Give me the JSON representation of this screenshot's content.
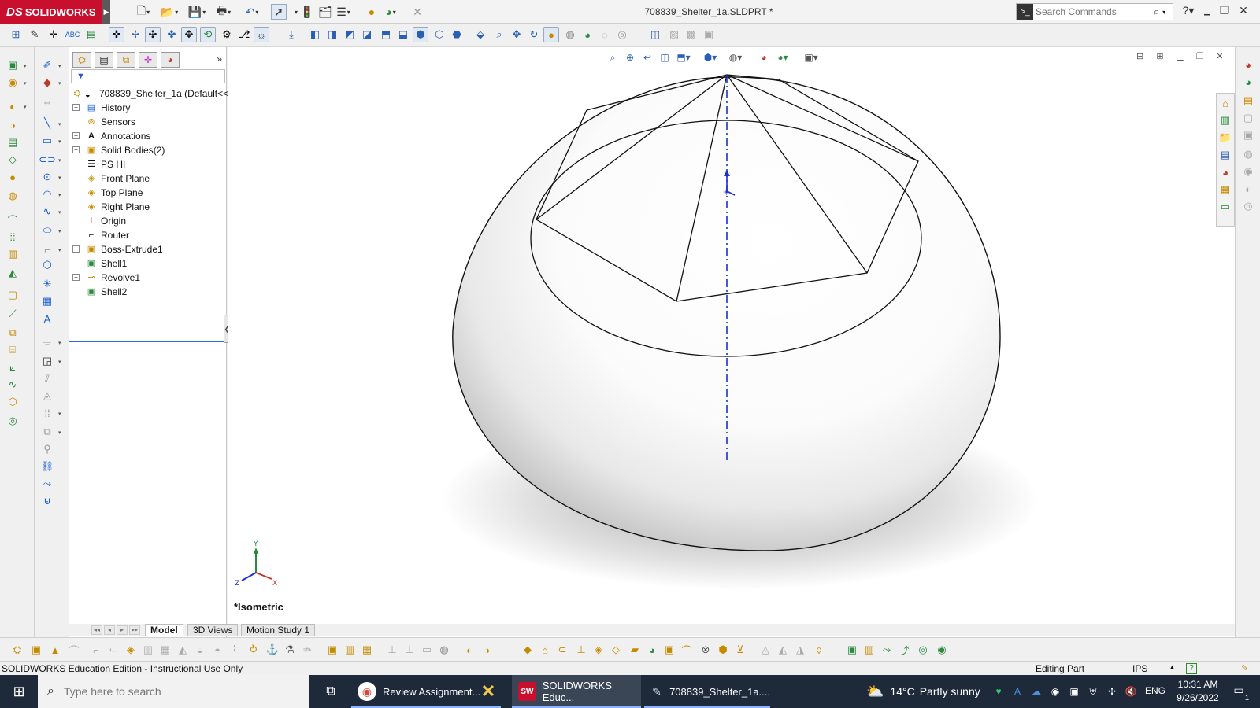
{
  "app": {
    "brand": "SOLIDWORKS",
    "brand_prefix": "DS",
    "document_title": "708839_Shelter_1a.SLDPRT *"
  },
  "search": {
    "placeholder": "Search Commands"
  },
  "feature_manager": {
    "root_label": "708839_Shelter_1a  (Default<<",
    "items": [
      {
        "label": "History",
        "icon": "history-icon",
        "expandable": true
      },
      {
        "label": "Sensors",
        "icon": "sensors-icon",
        "expandable": false
      },
      {
        "label": "Annotations",
        "icon": "annotations-icon",
        "expandable": true
      },
      {
        "label": "Solid Bodies(2)",
        "icon": "solid-bodies-icon",
        "expandable": true
      },
      {
        "label": "PS HI",
        "icon": "equations-icon",
        "expandable": false
      },
      {
        "label": "Front Plane",
        "icon": "plane-icon",
        "expandable": false
      },
      {
        "label": "Top Plane",
        "icon": "plane-icon",
        "expandable": false
      },
      {
        "label": "Right Plane",
        "icon": "plane-icon",
        "expandable": false
      },
      {
        "label": "Origin",
        "icon": "origin-icon",
        "expandable": false
      },
      {
        "label": "Router",
        "icon": "router-icon",
        "expandable": false
      },
      {
        "label": "Boss-Extrude1",
        "icon": "extrude-icon",
        "expandable": true
      },
      {
        "label": "Shell1",
        "icon": "shell-icon",
        "expandable": false
      },
      {
        "label": "Revolve1",
        "icon": "revolve-icon",
        "expandable": true
      },
      {
        "label": "Shell2",
        "icon": "shell-icon",
        "expandable": false
      }
    ]
  },
  "viewport": {
    "view_label": "*Isometric",
    "triad_axes": {
      "x": "X",
      "y": "Y",
      "z": "Z"
    }
  },
  "tabs": [
    {
      "label": "Model",
      "active": true
    },
    {
      "label": "3D Views",
      "active": false
    },
    {
      "label": "Motion Study 1",
      "active": false
    }
  ],
  "status": {
    "edition": "SOLIDWORKS Education Edition - Instructional Use Only",
    "mode": "Editing Part",
    "units": "IPS",
    "help": "?"
  },
  "taskbar": {
    "search_placeholder": "Type here to search",
    "apps": [
      {
        "label": "Review Assignment...",
        "icon": "chrome-icon",
        "active": false
      },
      {
        "label": "",
        "icon": "x-app-icon",
        "active": false
      },
      {
        "label": "SOLIDWORKS Educ...",
        "icon": "solidworks-icon",
        "active": true
      },
      {
        "label": "708839_Shelter_1a....",
        "icon": "solidworks-part-icon",
        "active": false
      }
    ],
    "weather": {
      "temp": "14°C",
      "desc": "Partly sunny"
    },
    "language": "ENG",
    "time": "10:31 AM",
    "date": "9/26/2022",
    "notification_count": "1"
  },
  "colors": {
    "brand_red": "#c8102e",
    "axis_blue": "#1a2fd4",
    "taskbar_bg": "#1e2a3a"
  }
}
